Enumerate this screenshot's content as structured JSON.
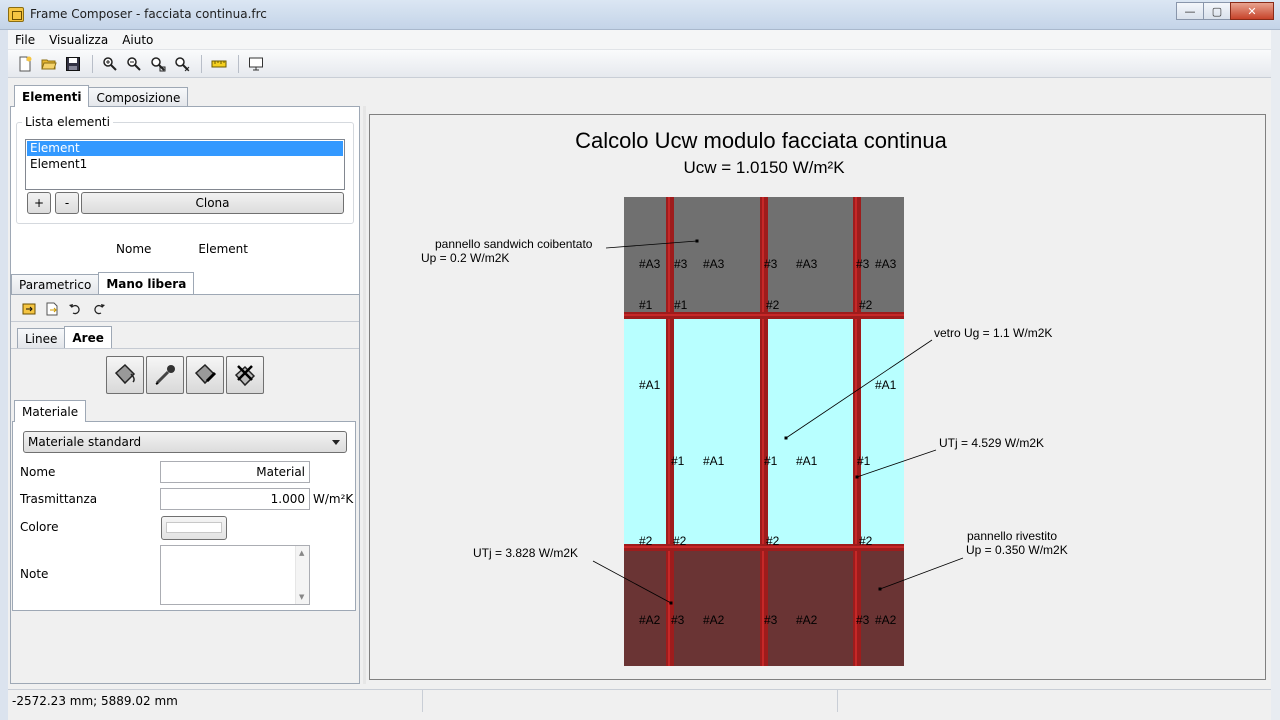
{
  "window": {
    "title": "Frame Composer - facciata continua.frc"
  },
  "window_buttons": {
    "minimize": "—",
    "maximize": "▢",
    "close": "✕"
  },
  "menu": [
    "File",
    "Visualizza",
    "Aiuto"
  ],
  "main_tabs": {
    "elementi": "Elementi",
    "composizione": "Composizione"
  },
  "elements_group": {
    "title": "Lista elementi",
    "items": [
      "Element",
      "Element1"
    ],
    "add_label": "+",
    "remove_label": "-",
    "clone_label": "Clona"
  },
  "name_field": {
    "label": "Nome",
    "value": "Element"
  },
  "mode_tabs": {
    "parametrico": "Parametrico",
    "mano_libera": "Mano libera"
  },
  "sub_tabs": {
    "linee": "Linee",
    "aree": "Aree"
  },
  "material": {
    "tab": "Materiale",
    "combo_value": "Materiale standard",
    "name_label": "Nome",
    "name_value": "Material",
    "trasm_label": "Trasmittanza",
    "trasm_value": "1.000",
    "trasm_unit": "W/m²K",
    "color_label": "Colore",
    "notes_label": "Note"
  },
  "canvas": {
    "title": "Calcolo Ucw modulo facciata continua",
    "subtitle": "Ucw = 1.0150 W/m²K",
    "labels": {
      "r1c1": "#A3",
      "r1c2a": "#3",
      "r1c2b": "#A3",
      "r1c3a": "#3",
      "r1c3b": "#A3",
      "r1c4a": "#3",
      "r1c4b": "#A3",
      "r1b1": "#1",
      "r1b2": "#1",
      "r1b3": "#2",
      "r1b4": "#2",
      "r2c1": "#A1",
      "r2c4": "#A1",
      "r2m1": "#1",
      "r2m2": "#A1",
      "r2m3": "#1",
      "r2m4": "#A1",
      "r2m5": "#1",
      "r2b1": "#2",
      "r2b2": "#2",
      "r2b3": "#2",
      "r2b4": "#2",
      "r3c1": "#A2",
      "r3c2a": "#3",
      "r3c2b": "#A2",
      "r3c3a": "#3",
      "r3c3b": "#A2",
      "r3c4a": "#3",
      "r3c4b": "#A2"
    },
    "annotations": {
      "sandwich_1": "pannello sandwich coibentato",
      "sandwich_2": "Up = 0.2 W/m2K",
      "vetro": "vetro Ug = 1.1 W/m2K",
      "utj1": "UTj = 4.529 W/m2K",
      "utj2": "UTj = 3.828 W/m2K",
      "rivestito_1": "pannello rivestito",
      "rivestito_2": "Up = 0.350 W/m2K"
    },
    "colors": {
      "opaque": "#707070",
      "glass": "#b8ffff",
      "cladding": "#6a3434",
      "frame": "#9e1c1c",
      "frame_light": "#c62828"
    }
  },
  "status": {
    "coords": "-2572.23 mm; 5889.02 mm"
  }
}
